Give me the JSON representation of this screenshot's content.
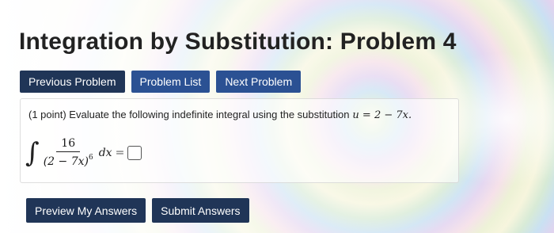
{
  "page": {
    "title": "Integration by Substitution: Problem 4"
  },
  "nav": {
    "previous_label": "Previous Problem",
    "list_label": "Problem List",
    "next_label": "Next Problem"
  },
  "problem": {
    "prompt": "(1 point) Evaluate the following indefinite integral using the substitution",
    "substitution": "u = 2 − 7x.",
    "integral_sign": "∫",
    "numerator": "16",
    "denominator": "(2 − 7x)",
    "exponent": "6",
    "differential": "dx",
    "equals": "=",
    "answer_value": ""
  },
  "actions": {
    "preview_label": "Preview My Answers",
    "submit_label": "Submit Answers"
  },
  "colors": {
    "dark_button": "#203557",
    "blue_button": "#2b5193"
  }
}
